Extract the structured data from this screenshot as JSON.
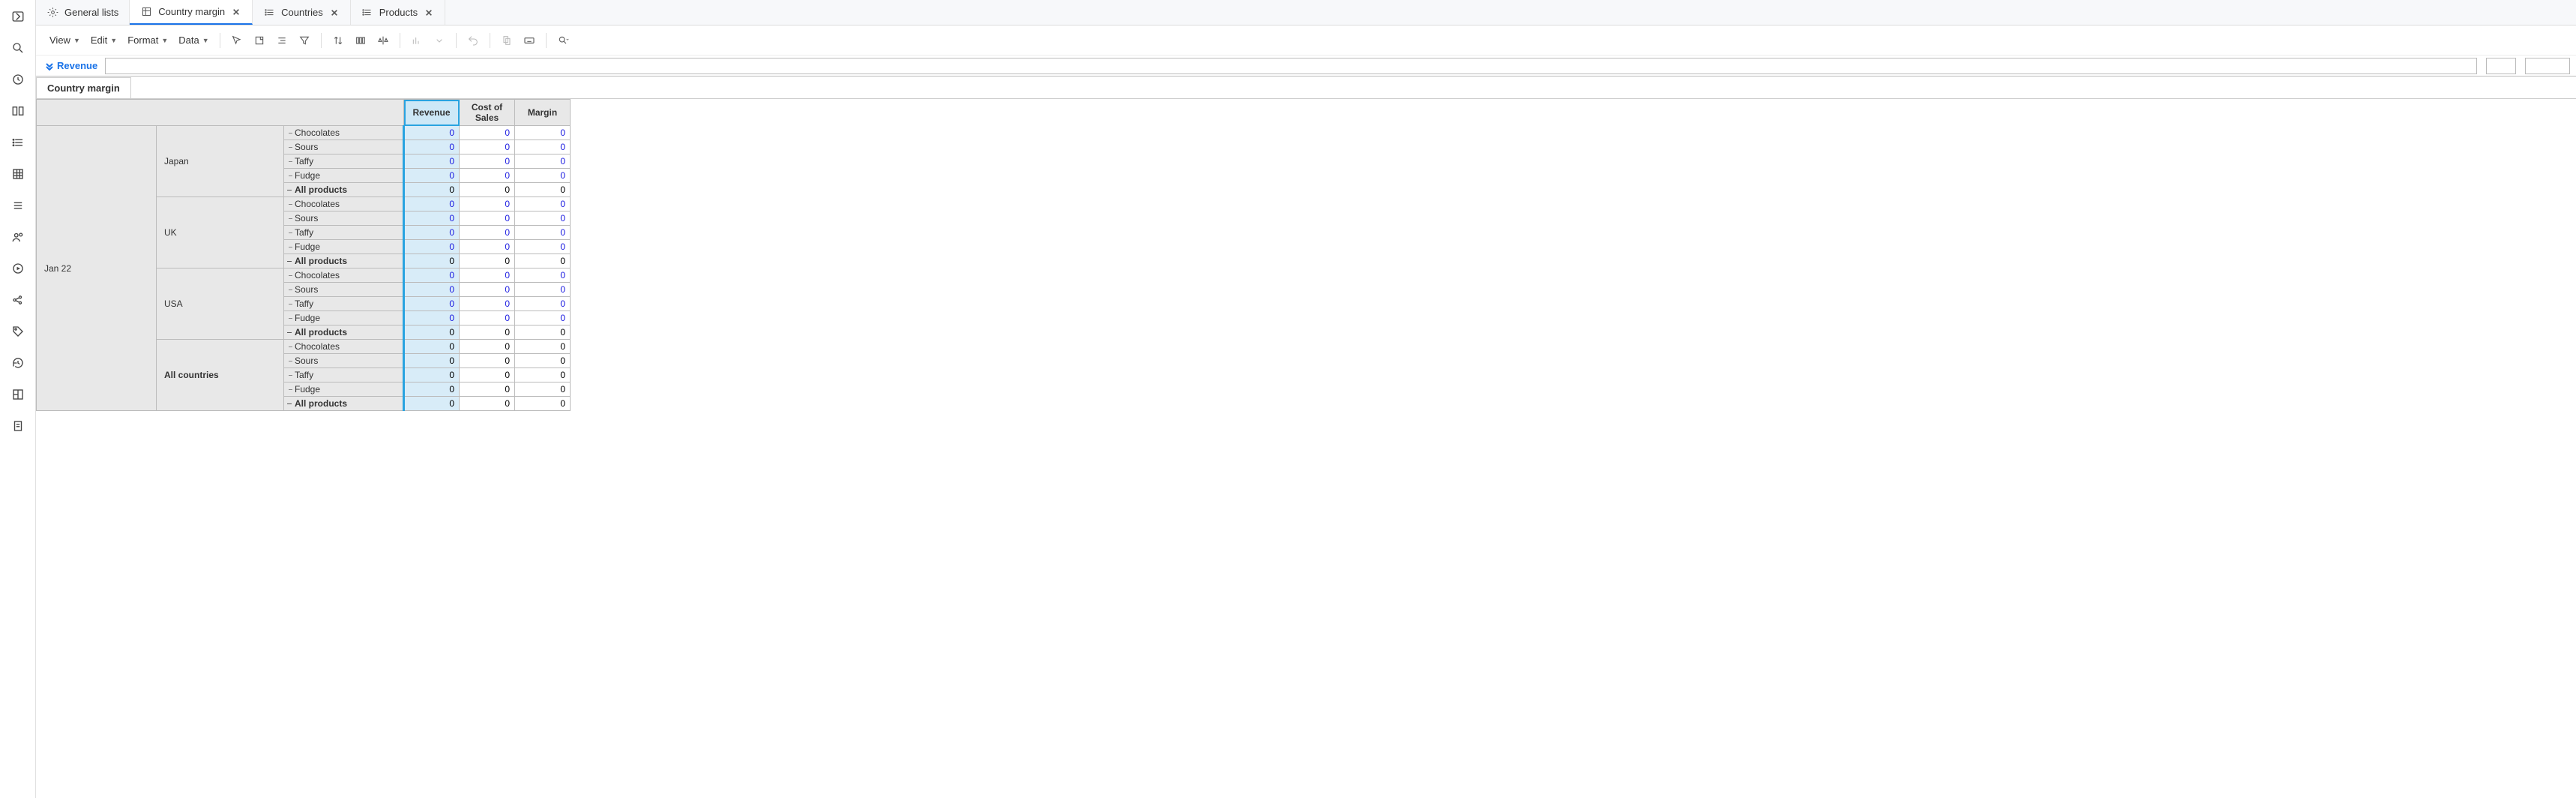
{
  "tabs": [
    {
      "label": "General lists"
    },
    {
      "label": "Country margin"
    },
    {
      "label": "Countries"
    },
    {
      "label": "Products"
    }
  ],
  "toolbar": {
    "view": "View",
    "edit": "Edit",
    "format": "Format",
    "data": "Data"
  },
  "formula": {
    "label": "Revenue",
    "value": ""
  },
  "sheet_tab": "Country margin",
  "columns": [
    "Revenue",
    "Cost of Sales",
    "Margin"
  ],
  "time_label": "Jan 22",
  "countries": [
    "Japan",
    "UK",
    "USA",
    "All countries"
  ],
  "products": [
    "Chocolates",
    "Sours",
    "Taffy",
    "Fudge",
    "All products"
  ],
  "zero": "0"
}
